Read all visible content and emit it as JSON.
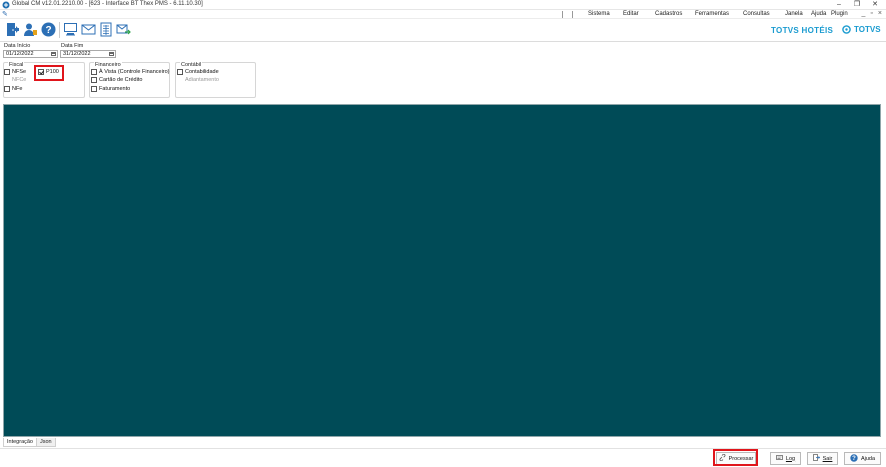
{
  "window": {
    "title": "Global CM v12.01.2210.00 - [623 - Interface BT Thex PMS - 6.11.10.30]"
  },
  "menubar": {
    "items": [
      "Sistema",
      "Editar",
      "Cadastros",
      "Ferramentas",
      "Consultas",
      "Janela",
      "Ajuda",
      "Plugin"
    ]
  },
  "brand": {
    "hotel": "TOTVS HOTÉIS",
    "totvs": "TOTVS"
  },
  "filters": {
    "data_inicio_label": "Data Início",
    "data_inicio_value": "01/12/2022",
    "data_fim_label": "Data Fim",
    "data_fim_value": "31/12/2022"
  },
  "fiscal": {
    "title": "Fiscal",
    "nfse": {
      "label": "NFSe",
      "checked": false
    },
    "nfce": {
      "label": "NFCe",
      "enabled": false
    },
    "nfe": {
      "label": "NFe",
      "checked": false
    },
    "p100": {
      "label": "P100",
      "checked": true
    }
  },
  "financeiro": {
    "title": "Financeiro",
    "avista": {
      "label": "À Vista (Controle Financeiro)",
      "checked": false
    },
    "cartao": {
      "label": "Cartão de Crédito",
      "checked": false
    },
    "faturamento": {
      "label": "Faturamento",
      "checked": false
    }
  },
  "contabil": {
    "title": "Contábil",
    "contabilidade": {
      "label": "Contabilidade",
      "checked": false
    },
    "adiantamento": {
      "label": "Adiantamento",
      "enabled": false
    }
  },
  "tabs": [
    "Integração",
    "Json"
  ],
  "buttons": {
    "processar": "Processar",
    "log": "Log",
    "sair": "Sair",
    "ajuda": "Ajuda"
  },
  "colors": {
    "main_panel": "#004b57",
    "highlight": "#e0151b",
    "brand": "#1a9bd0"
  }
}
